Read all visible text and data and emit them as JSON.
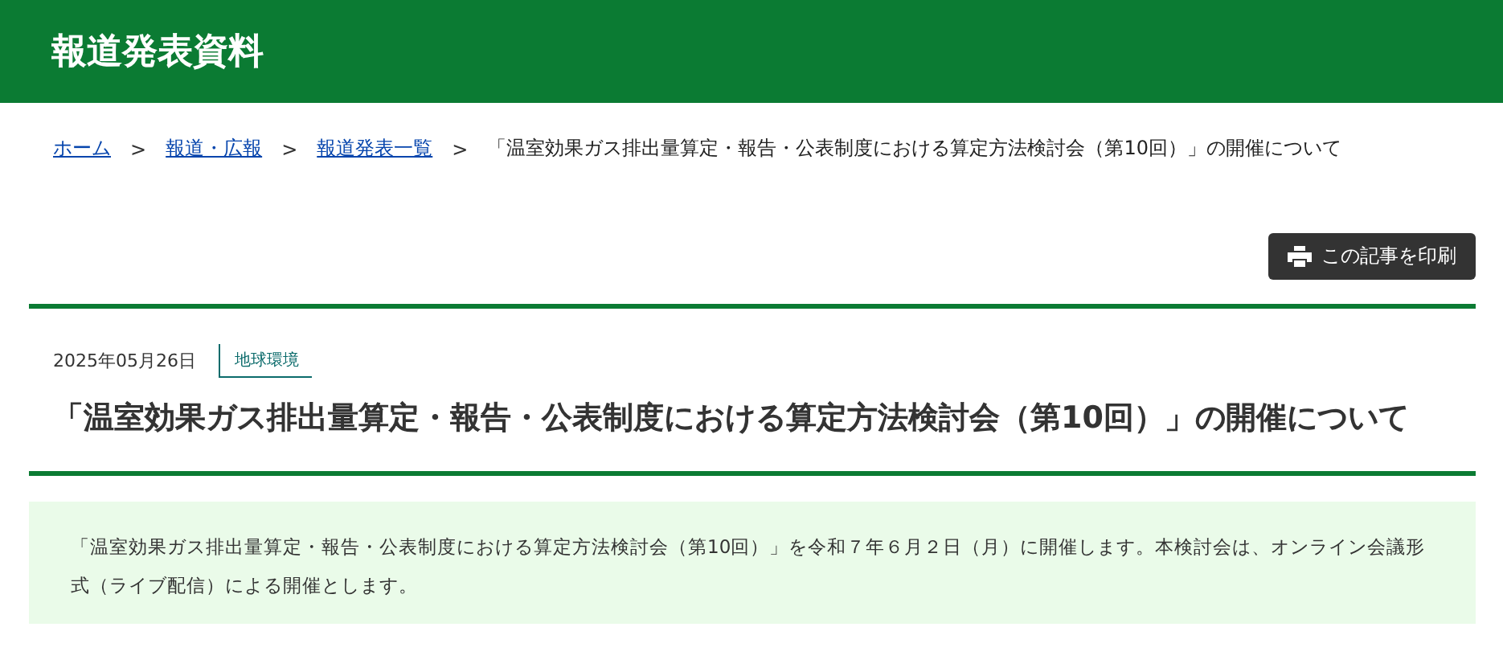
{
  "header": {
    "title": "報道発表資料"
  },
  "breadcrumb": {
    "links": [
      {
        "label": "ホーム",
        "separator": ">"
      },
      {
        "label": "報道・広報",
        "separator": ">"
      },
      {
        "label": "報道発表一覧",
        "separator": ">"
      }
    ],
    "current": "「温室効果ガス排出量算定・報告・公表制度における算定方法検討会（第10回）」の開催について"
  },
  "print_button": {
    "label": "この記事を印刷"
  },
  "article": {
    "date": "2025年05月26日",
    "tag": "地球環境",
    "title": "「温室効果ガス排出量算定・報告・公表制度における算定方法検討会（第10回）」の開催について",
    "summary": "「温室効果ガス排出量算定・報告・公表制度における算定方法検討会（第10回）」を令和７年６月２日（月）に開催します。本検討会は、オンライン会議形式（ライブ配信）による開催とします。"
  }
}
